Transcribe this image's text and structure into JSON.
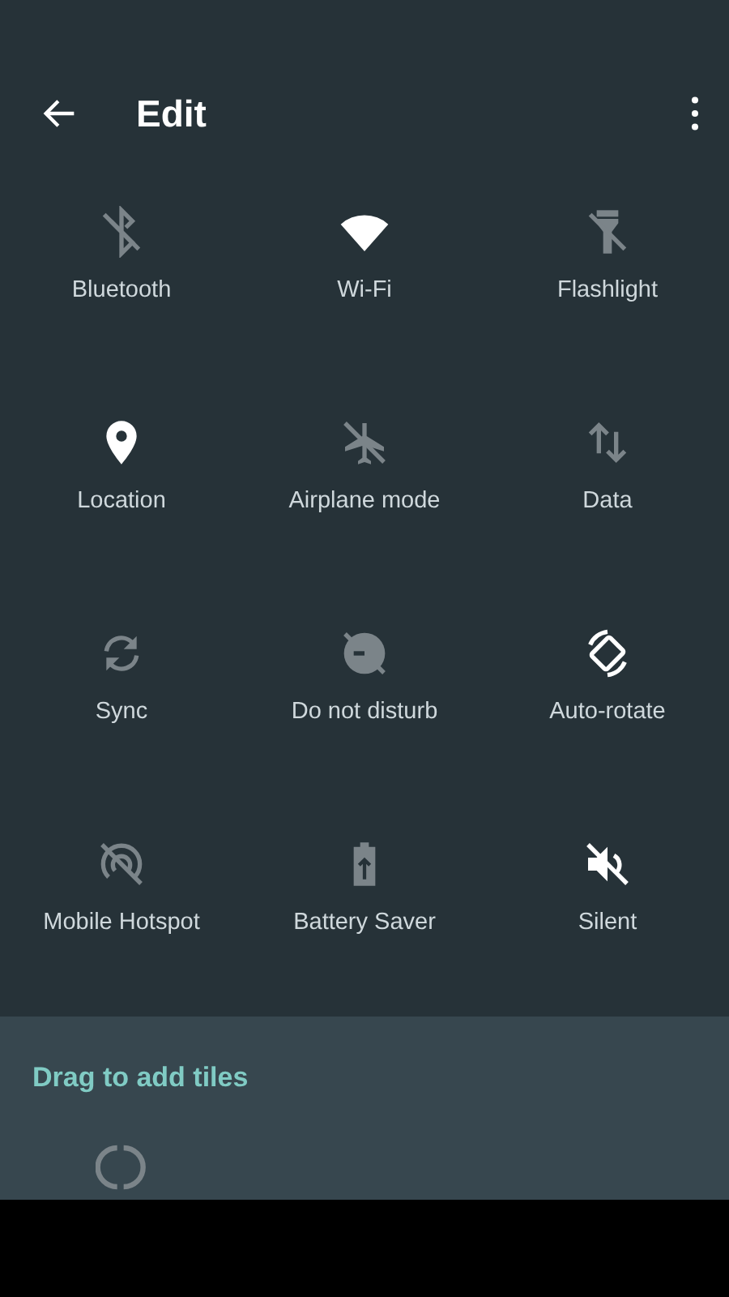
{
  "toolbar": {
    "title": "Edit"
  },
  "tiles": [
    {
      "kind": "bluetooth",
      "label": "Bluetooth",
      "on": false
    },
    {
      "kind": "wifi",
      "label": "Wi-Fi",
      "on": true
    },
    {
      "kind": "flashlight",
      "label": "Flashlight",
      "on": false
    },
    {
      "kind": "location",
      "label": "Location",
      "on": true
    },
    {
      "kind": "airplane",
      "label": "Airplane mode",
      "on": false
    },
    {
      "kind": "data",
      "label": "Data",
      "on": false
    },
    {
      "kind": "sync",
      "label": "Sync",
      "on": false
    },
    {
      "kind": "dnd",
      "label": "Do not disturb",
      "on": false
    },
    {
      "kind": "rotate",
      "label": "Auto-rotate",
      "on": true
    },
    {
      "kind": "hotspot",
      "label": "Mobile Hotspot",
      "on": false
    },
    {
      "kind": "battery",
      "label": "Battery Saver",
      "on": false
    },
    {
      "kind": "silent",
      "label": "Silent",
      "on": true
    }
  ],
  "add_tiles": {
    "title": "Drag to add tiles",
    "tiles": [
      {
        "kind": "refresh"
      }
    ]
  }
}
